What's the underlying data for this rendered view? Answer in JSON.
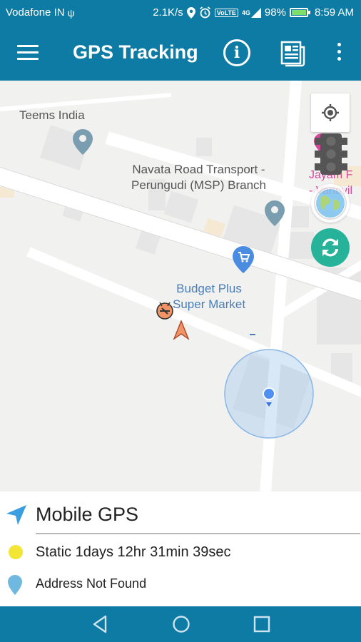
{
  "status_bar": {
    "carrier": "Vodafone IN",
    "speed": "2.1K/s",
    "volte": "VoLTE",
    "network": "4G",
    "battery": "98%",
    "battery_level": 0.98,
    "time": "8:59 AM"
  },
  "app_bar": {
    "title": "GPS Tracking",
    "info_icon_letter": "i",
    "icons": [
      "menu-icon",
      "info-icon",
      "report-icon",
      "more-vert-icon"
    ],
    "color": "#0e7ba5"
  },
  "map": {
    "places": [
      {
        "label": "Teems India"
      },
      {
        "label": "Navata Road Transport -\nPerungudi (MSP) Branch"
      },
      {
        "label": "Budget Plus\nSuper Market"
      },
      {
        "label": "Jayam F\n- Vanavil"
      }
    ],
    "buttons": [
      "my-location-icon",
      "traffic-icon",
      "globe-icon",
      "refresh-icon"
    ]
  },
  "panel": {
    "title": "Mobile GPS",
    "status": "Static 1days 12hr 31min 39sec",
    "address": "Address Not Found"
  },
  "colors": {
    "primary": "#0e7ba5",
    "refresh": "#26b39a",
    "accuracy": "#a9cbee",
    "status_dot": "#f2e535",
    "pin": "#6fb8e0"
  }
}
